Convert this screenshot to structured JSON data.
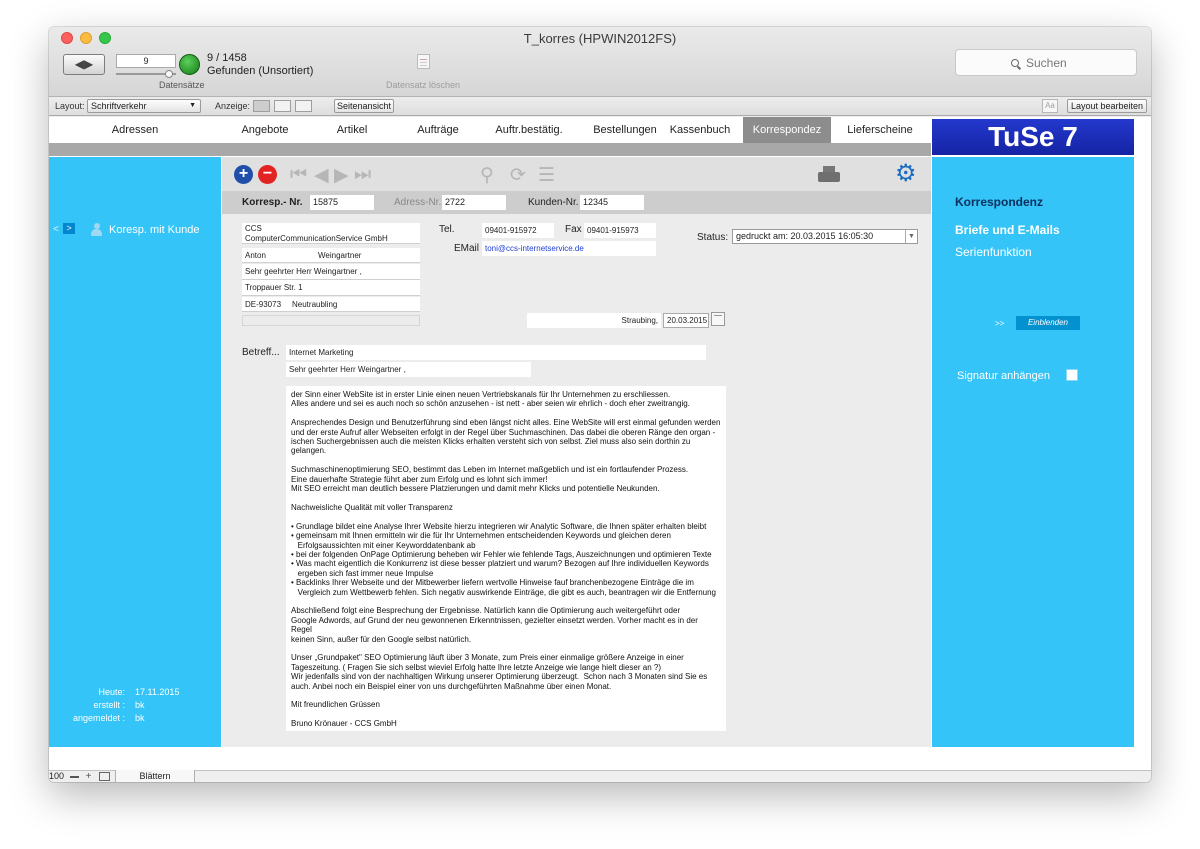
{
  "window": {
    "title": "T_korres (HPWIN2012FS)",
    "controls": {
      "close_color": "#fc615d",
      "minimize_color": "#fdbc40",
      "zoom_color": "#34c84a"
    }
  },
  "toolbar": {
    "nav_arrows_icon": "◀▶",
    "record_number": "9",
    "found_count": "9 / 1458",
    "found_status": "Gefunden (Unsortiert)",
    "records_label": "Datensätze",
    "delete_record_label": "Datensatz löschen",
    "search_placeholder": "Suchen"
  },
  "layout_bar": {
    "layout_label": "Layout:",
    "layout_value": "Schriftverkehr",
    "view_label": "Anzeige:",
    "page_view_button": "Seitenansicht",
    "format_icon": "Aa",
    "edit_layout_button": "Layout bearbeiten"
  },
  "tabs": [
    {
      "label": "Adressen"
    },
    {
      "label": "Angebote"
    },
    {
      "label": "Artikel"
    },
    {
      "label": "Aufträge"
    },
    {
      "label": "Auftr.bestätig."
    },
    {
      "label": "Bestellungen"
    },
    {
      "label": "Kassenbuch"
    },
    {
      "label": "Korrespondez",
      "active": true
    },
    {
      "label": "Lieferscheine"
    }
  ],
  "brand": {
    "text": "TuSe 7"
  },
  "left_panel": {
    "nav_back": "<",
    "nav_forward": ">",
    "link": "Koresp. mit Kunde",
    "info": [
      {
        "label": "Heute:",
        "value": "17.11.2015"
      },
      {
        "label": "erstellt :",
        "value": "bk"
      },
      {
        "label": "angemeldet :",
        "value": "bk"
      }
    ]
  },
  "record_bar": {
    "korresp_label": "Korresp.- Nr.",
    "korresp_value": "15875",
    "adress_label": "Adress-Nr.",
    "adress_value": "2722",
    "kunden_label": "Kunden-Nr.",
    "kunden_value": "12345"
  },
  "address": {
    "company_line1": "CCS",
    "company_line2": "ComputerCommunicationService GmbH",
    "first_name": "Anton",
    "last_name": "Weingartner",
    "salutation": "Sehr geehrter Herr  Weingartner ,",
    "street": "Troppauer Str. 1",
    "zip": "DE-93073",
    "city": "Neutraubling",
    "extra": ""
  },
  "contact": {
    "tel_label": "Tel.",
    "tel_value": "09401-915972",
    "fax_label": "Fax",
    "fax_value": "09401-915973",
    "email_label": "EMail",
    "email_value": "toni@ccs-internetservice.de",
    "email_color": "#1f3fd6"
  },
  "status": {
    "label": "Status:",
    "value": "gedruckt am:  20.03.2015 16:05:30"
  },
  "letter": {
    "place": "Straubing,",
    "date": "20.03.2015",
    "subject_label": "Betreff...",
    "subject": "Internet Marketing",
    "salutation": "Sehr geehrter Herr  Weingartner ,",
    "body": "der Sinn einer WebSite ist in erster Linie einen neuen Vertriebskanals für Ihr Unternehmen zu erschliessen.\nAlles andere und sei es auch noch so schön anzusehen - ist nett - aber seien wir ehrlich - doch eher zweitrangig.\n\nAnsprechendes Design und Benutzerführung sind eben längst nicht alles. Eine WebSite will erst einmal gefunden werden\nund der erste Aufruf aller Webseiten erfolgt in der Regel über Suchmaschinen. Das dabei die oberen Ränge den organ -\nischen Suchergebnissen auch die meisten Klicks erhalten versteht sich von selbst. Ziel muss also sein dorthin zu\ngelangen.\n\nSuchmaschinenoptimierung SEO, bestimmt das Leben im Internet maßgeblich und ist ein fortlaufender Prozess.\nEine dauerhafte Strategie führt aber zum Erfolg und es lohnt sich immer!\nMit SEO erreicht man deutlich bessere Platzierungen und damit mehr Klicks und potentielle Neukunden.\n\nNachweisliche Qualität mit voller Transparenz\n\n• Grundlage bildet eine Analyse Ihrer Website hierzu integrieren wir Analytic Software, die Ihnen später erhalten bleibt\n• gemeinsam mit Ihnen ermitteln wir die für Ihr Unternehmen entscheidenden Keywords und gleichen deren\n   Erfolgsaussichten mit einer Keyworddatenbank ab\n• bei der folgenden OnPage Optimierung beheben wir Fehler wie fehlende Tags, Auszeichnungen und optimieren Texte\n• Was macht eigentlich die Konkurrenz ist diese besser platziert und warum? Bezogen auf Ihre individuellen Keywords\n   ergeben sich fast immer neue Impulse\n• Backlinks Ihrer Webseite und der Mitbewerber liefern wertvolle Hinweise fauf branchenbezogene Einträge die im\n   Vergleich zum Wettbewerb fehlen. Sich negativ auswirkende Einträge, die gibt es auch, beantragen wir die Entfernung\n\nAbschließend folgt eine Besprechung der Ergebnisse. Natürlich kann die Optimierung auch weitergeführt oder\nGoogle Adwords, auf Grund der neu gewonnenen Erkenntnissen, gezielter einsetzt werden. Vorher macht es in der Regel\nkeinen Sinn, außer für den Google selbst natürlich.\n\nUnser „Grundpaket\" SEO Optimierung läuft über 3 Monate, zum Preis einer einmalige größere Anzeige in einer\nTageszeitung. ( Fragen Sie sich selbst wieviel Erfolg hatte Ihre letzte Anzeige wie lange hielt dieser an ?)\nWir jedenfalls sind von der nachhaltigen Wirkung unserer Optimierung überzeugt.  Schon nach 3 Monaten sind Sie es\nauch. Anbei noch ein Beispiel einer von uns durchgeführten Maßnahme über einen Monat.\n\nMit freundlichen Grüssen\n\nBruno Krönauer - CCS GmbH"
  },
  "right_panel": {
    "title": "Korrespondenz",
    "item1": "Briefe und E-Mails",
    "item2": "Serienfunktion",
    "arrows": ">>",
    "show_button": "Einblenden",
    "signature_label": "Signatur anhängen",
    "signature_checked": false
  },
  "statusbar": {
    "zoom": "100",
    "mode": "Blättern"
  },
  "colors": {
    "panel_blue": "#34c4f8",
    "brand_blue": "#1a2dbd",
    "active_tab": "#8d8d8d",
    "add_button": "#1f4fa8",
    "remove_button": "#e32222"
  },
  "icons": {
    "add": "+",
    "remove": "−",
    "first": "⏮",
    "prev": "◀",
    "next": "▶",
    "last": "⏭",
    "search": "⚲",
    "refresh": "⟳",
    "list": "☰",
    "gear": "⚙",
    "zoom_in": "+"
  }
}
